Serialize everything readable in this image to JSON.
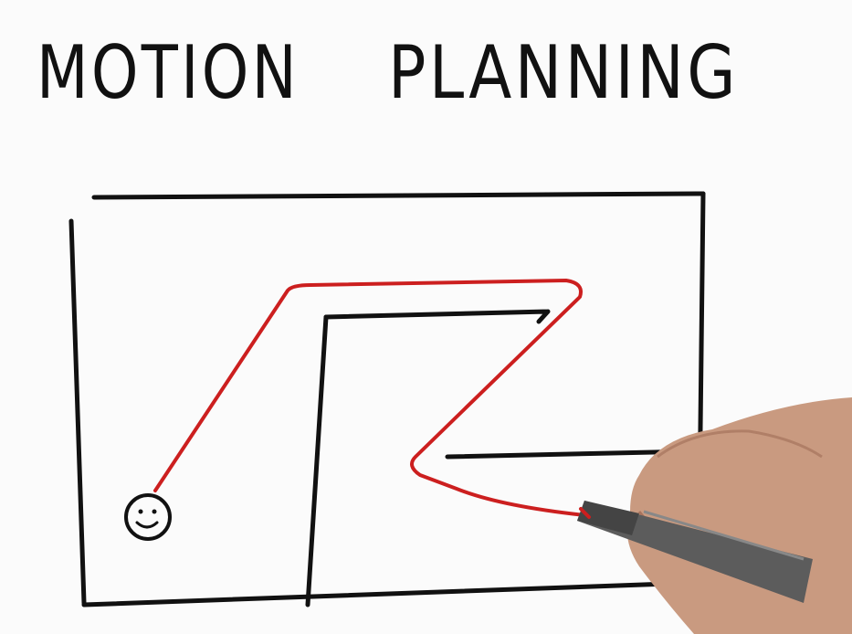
{
  "title": {
    "word1": "MOTION",
    "word2": "PLANNING"
  },
  "maze": {
    "goal_symbol": "$",
    "start_icon": "smiley-face-icon",
    "path_color": "#cc1f1f",
    "wall_color": "#111111"
  }
}
